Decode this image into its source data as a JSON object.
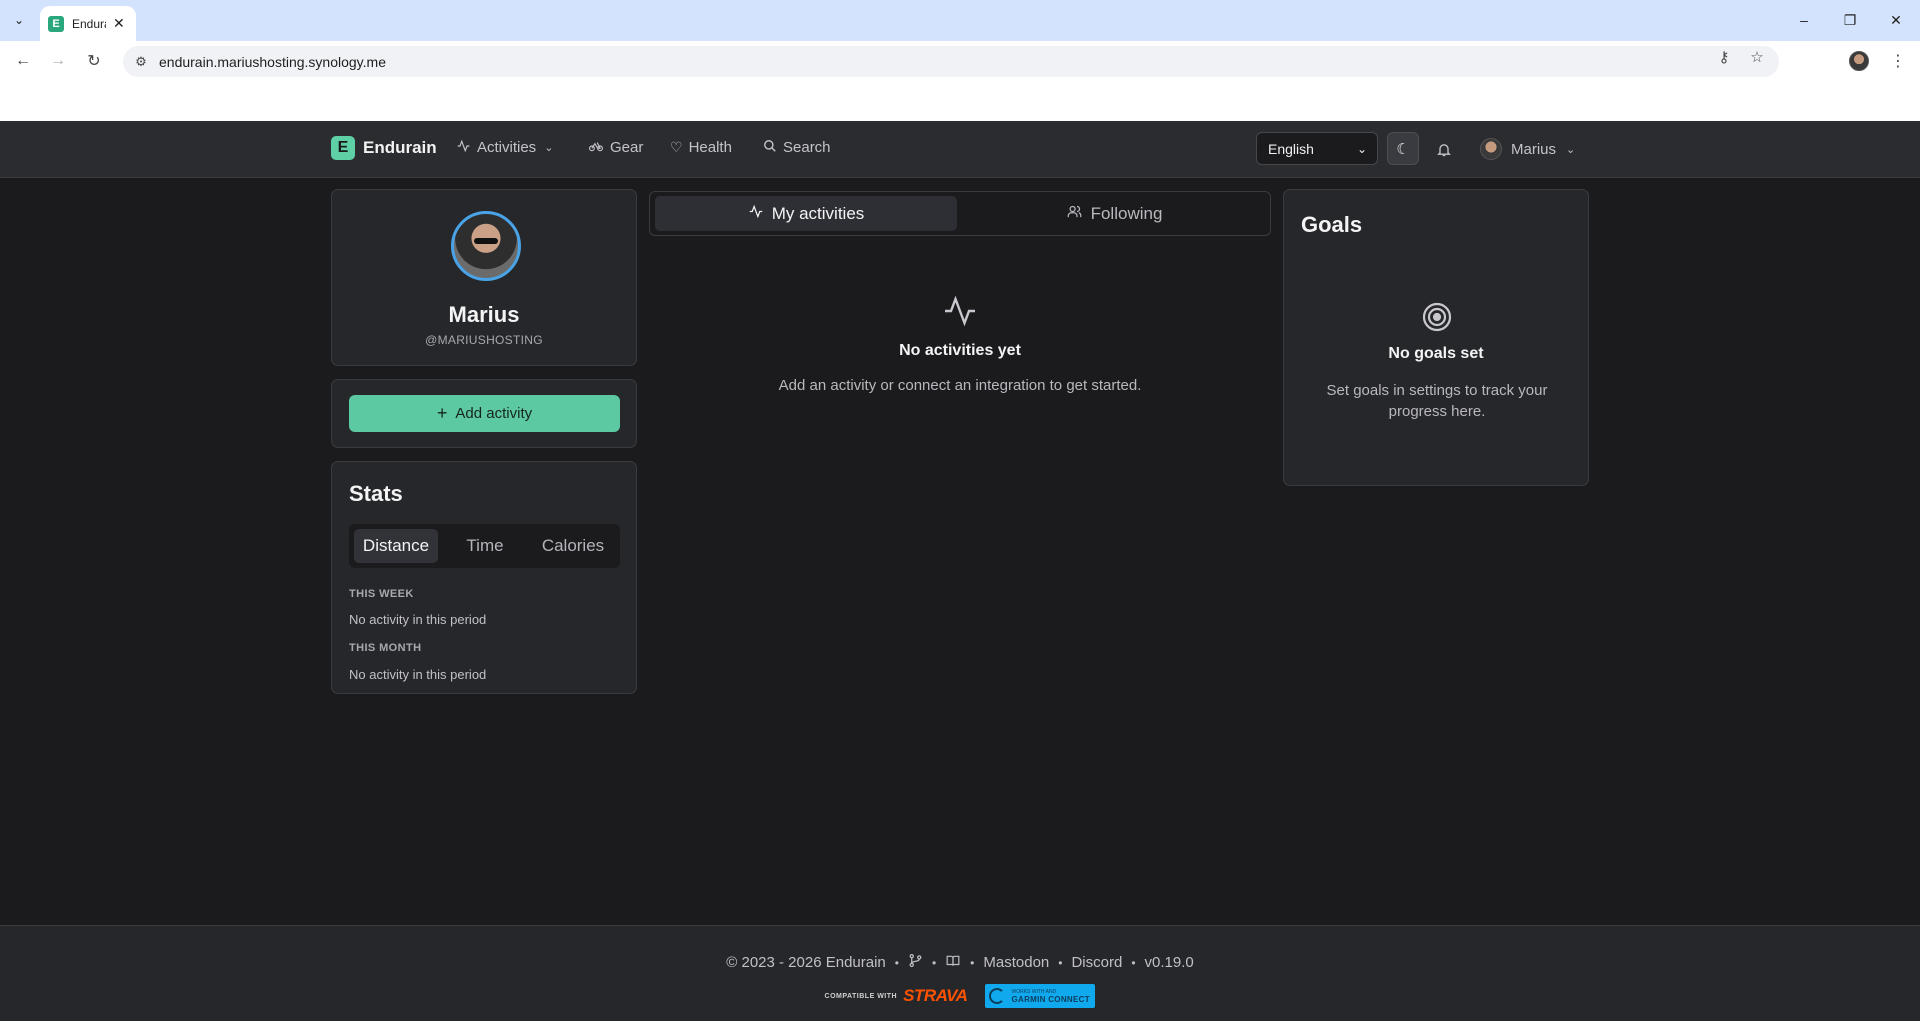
{
  "browser": {
    "tab_title": "Endurain",
    "url": "endurain.mariushosting.synology.me",
    "tab_close": "✕",
    "window_controls": {
      "minimize": "–",
      "restore": "❐",
      "close": "✕"
    }
  },
  "navbar": {
    "brand": "Endurain",
    "items": [
      {
        "label": "Activities",
        "icon": "activity-icon"
      },
      {
        "label": "Gear",
        "icon": "bike-icon"
      },
      {
        "label": "Health",
        "icon": "heart-icon"
      },
      {
        "label": "Search",
        "icon": "search-icon"
      }
    ],
    "language": "English",
    "user_name": "Marius"
  },
  "profile": {
    "name": "Marius",
    "handle": "@MARIUSHOSTING"
  },
  "add_activity": {
    "label": "Add activity"
  },
  "stats": {
    "title": "Stats",
    "tabs": [
      "Distance",
      "Time",
      "Calories"
    ],
    "active_tab": "Distance",
    "periods": [
      {
        "label": "THIS WEEK",
        "text": "No activity in this period"
      },
      {
        "label": "THIS MONTH",
        "text": "No activity in this period"
      }
    ]
  },
  "feed": {
    "tabs": [
      {
        "label": "My activities",
        "icon": "activity-icon",
        "active": true
      },
      {
        "label": "Following",
        "icon": "users-icon",
        "active": false
      }
    ],
    "empty_title": "No activities yet",
    "empty_subtitle": "Add an activity or connect an integration to get started."
  },
  "goals": {
    "title": "Goals",
    "empty_title": "No goals set",
    "empty_subtitle": "Set goals in settings to track your progress here."
  },
  "footer": {
    "copyright": "© 2023 - 2026 Endurain",
    "links": [
      "Mastodon",
      "Discord"
    ],
    "version": "v0.19.0",
    "strava_small": "COMPATIBLE WITH",
    "strava_word": "STRAVA",
    "garmin_small": "WORKS WITH AND",
    "garmin_big": "GARMIN CONNECT"
  },
  "colors": {
    "accent": "#5cc9a2",
    "background": "#1b1b1e",
    "card": "#26272b",
    "avatar_ring": "#4aa3e6"
  }
}
